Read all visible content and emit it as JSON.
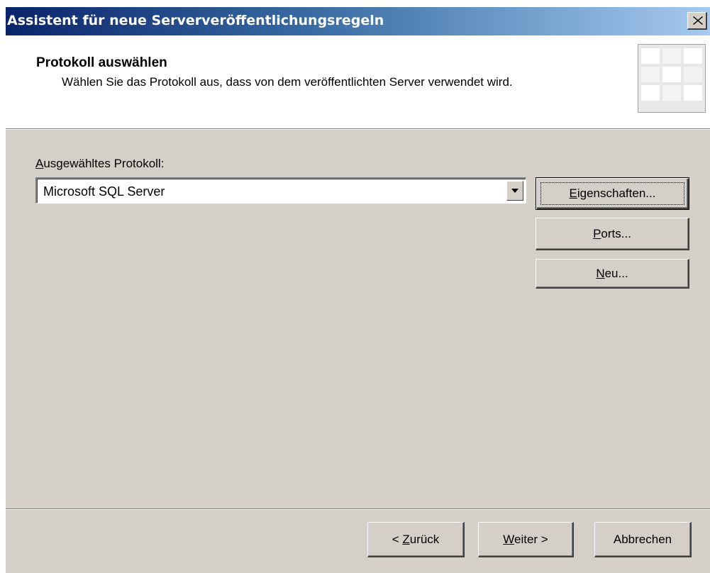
{
  "window": {
    "title": "Assistent für neue Serververöffentlichungsregeln",
    "close_icon": "close-icon"
  },
  "header": {
    "title": "Protokoll auswählen",
    "description": "Wählen Sie das Protokoll aus, dass von dem veröffentlichten Server verwendet wird."
  },
  "form": {
    "label_mnemonic": "A",
    "label_rest": "usgewähltes Protokoll:",
    "selected_protocol": "Microsoft SQL Server"
  },
  "side_buttons": {
    "properties": {
      "mnemonic": "E",
      "rest": "igenschaften..."
    },
    "ports": {
      "mnemonic": "P",
      "rest": "orts..."
    },
    "new": {
      "mnemonic": "N",
      "rest": "eu..."
    }
  },
  "footer": {
    "back": {
      "prefix": "< ",
      "mnemonic": "Z",
      "rest": "urück"
    },
    "next": {
      "mnemonic": "W",
      "rest": "eiter >"
    },
    "cancel": "Abbrechen"
  },
  "colors": {
    "title_gradient_start": "#0a246a",
    "title_gradient_end": "#a6caf0",
    "dialog_face": "#d4d0c8"
  }
}
